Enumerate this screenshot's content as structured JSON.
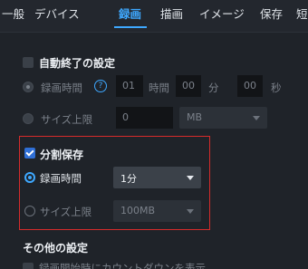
{
  "tabs": [
    "一般",
    "デバイス",
    "録画",
    "描画",
    "イメージ",
    "保存",
    "短"
  ],
  "active_tab": "録画",
  "auto_stop": {
    "title": "自動終了の設定",
    "time_label": "録画時間",
    "help": "?",
    "hours": "01",
    "hours_unit": "時間",
    "minutes": "00",
    "minutes_unit": "分",
    "seconds": "00",
    "seconds_unit": "秒",
    "size_label": "サイズ上限",
    "size_value": "0",
    "size_unit": "MB"
  },
  "split_save": {
    "title": "分割保存",
    "time_label": "録画時間",
    "time_value": "1分",
    "size_label": "サイズ上限",
    "size_value": "100MB"
  },
  "other": {
    "title": "その他の設定",
    "countdown_label": "録画開始時にカウントダウンを表示"
  },
  "colors": {
    "accent": "#3ea8ff",
    "highlight": "#d62b2b",
    "background": "#1f2329"
  }
}
